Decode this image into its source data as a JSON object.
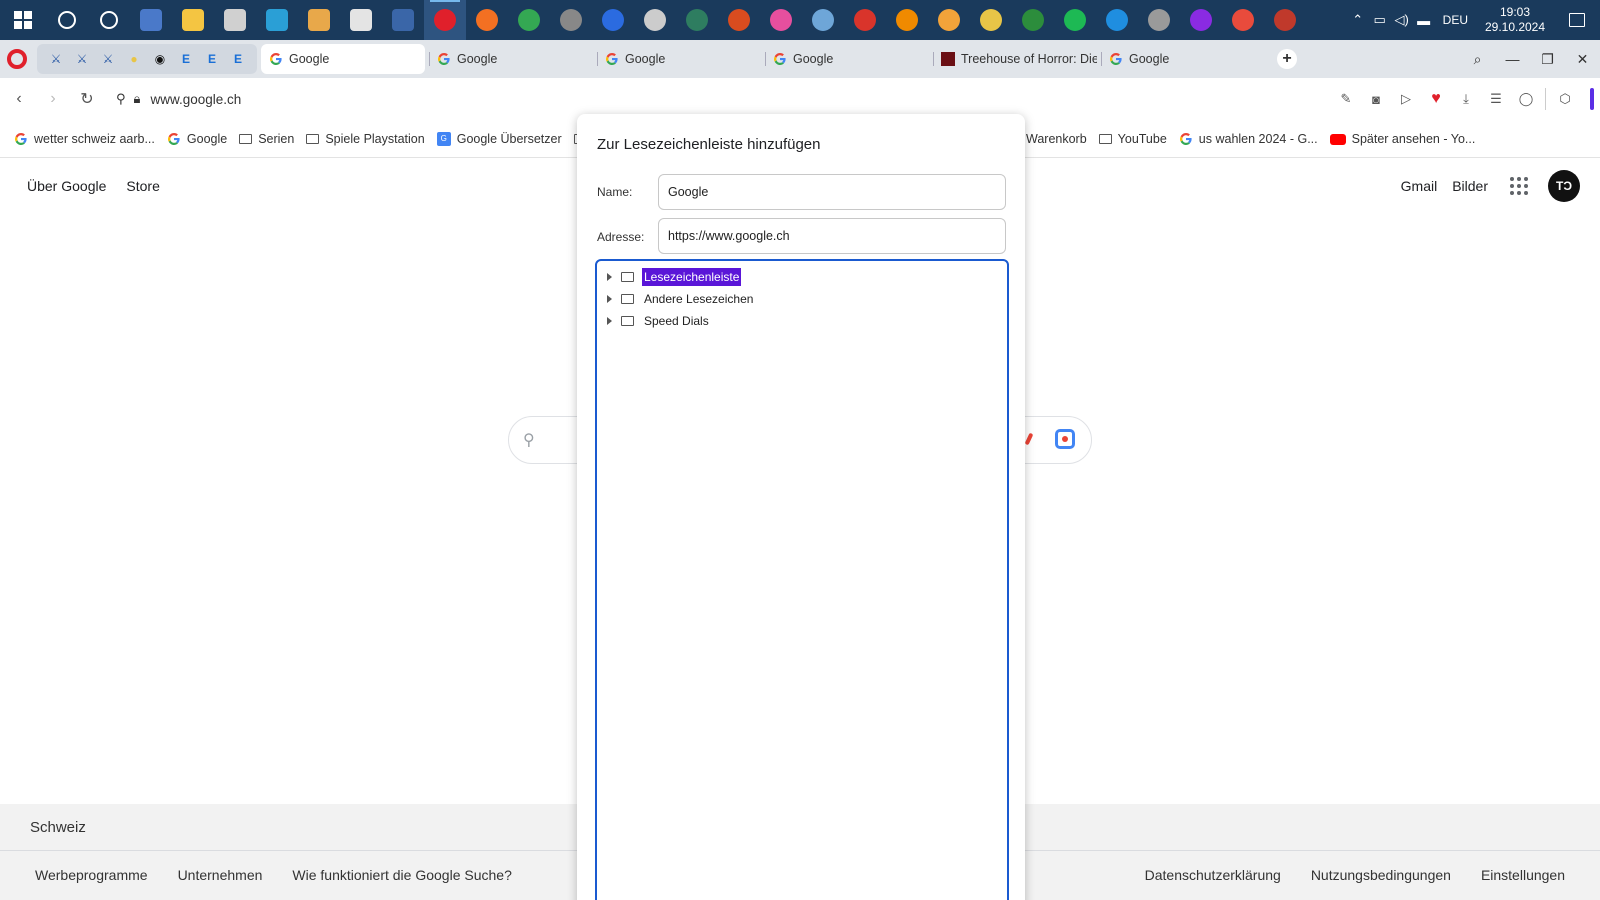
{
  "taskbar": {
    "apps": [
      {
        "name": "search-icon",
        "color": "#ffffff"
      },
      {
        "name": "task-view-icon",
        "color": "#ffffff"
      },
      {
        "name": "notepad-icon",
        "color": "#4a79c9"
      },
      {
        "name": "file-explorer-icon",
        "color": "#f4c542"
      },
      {
        "name": "app-icon",
        "color": "#d0d0d0"
      },
      {
        "name": "app-icon",
        "color": "#2a9fd6"
      },
      {
        "name": "app-icon",
        "color": "#e8a84a"
      },
      {
        "name": "paint-icon",
        "color": "#e4e4e4"
      },
      {
        "name": "app-icon",
        "color": "#3a66a8"
      },
      {
        "name": "opera-icon",
        "color": "#e0202b"
      },
      {
        "name": "firefox-icon",
        "color": "#f37022"
      },
      {
        "name": "chrome-icon",
        "color": "#34a853"
      },
      {
        "name": "app-icon",
        "color": "#888888"
      },
      {
        "name": "app-icon",
        "color": "#2b6be0"
      },
      {
        "name": "app-icon",
        "color": "#cccccc"
      },
      {
        "name": "app-icon",
        "color": "#2e7d60"
      },
      {
        "name": "app-icon",
        "color": "#d94c1f"
      },
      {
        "name": "itunes-icon",
        "color": "#e64f9e"
      },
      {
        "name": "app-icon",
        "color": "#6ea6d8"
      },
      {
        "name": "pdf-icon",
        "color": "#d9342b"
      },
      {
        "name": "vlc-icon",
        "color": "#f08a00"
      },
      {
        "name": "app-icon",
        "color": "#f2a33a"
      },
      {
        "name": "app-icon",
        "color": "#e8c547"
      },
      {
        "name": "app-icon",
        "color": "#2c8d3c"
      },
      {
        "name": "spotify-icon",
        "color": "#1db954"
      },
      {
        "name": "app-icon",
        "color": "#1f8ee0"
      },
      {
        "name": "app-icon",
        "color": "#9a9a9a"
      },
      {
        "name": "app-icon",
        "color": "#8a2be2"
      },
      {
        "name": "app-icon",
        "color": "#e94b3c"
      },
      {
        "name": "app-icon",
        "color": "#c0392b"
      }
    ],
    "tray": {
      "language": "DEU",
      "time": "19:03",
      "date": "29.10.2024"
    }
  },
  "tabs": [
    {
      "label": "Google",
      "active": true
    },
    {
      "label": "Google",
      "active": false
    },
    {
      "label": "Google",
      "active": false
    },
    {
      "label": "Google",
      "active": false
    },
    {
      "label": "Treehouse of Horror: Die S",
      "active": false
    },
    {
      "label": "Google",
      "active": false
    }
  ],
  "address_bar": {
    "url": "www.google.ch"
  },
  "bookmarks_bar": {
    "left": [
      {
        "label": "wetter schweiz aarb...",
        "icon": "google"
      },
      {
        "label": "Google",
        "icon": "google"
      },
      {
        "label": "Serien",
        "icon": "folder"
      },
      {
        "label": "Spiele Playstation",
        "icon": "folder"
      },
      {
        "label": "Google Übersetzer",
        "icon": "translate"
      }
    ],
    "right": [
      {
        "label": "Warenkorb",
        "icon": "none"
      },
      {
        "label": "YouTube",
        "icon": "folder"
      },
      {
        "label": "us wahlen 2024 - G...",
        "icon": "google"
      },
      {
        "label": "Später ansehen - Yo...",
        "icon": "youtube"
      }
    ]
  },
  "google_page": {
    "top_left_links": [
      "Über Google",
      "Store"
    ],
    "top_right_links": [
      "Gmail",
      "Bilder"
    ],
    "avatar_text": "TƆ",
    "footer": {
      "country": "Schweiz",
      "left_links": [
        "Werbeprogramme",
        "Unternehmen",
        "Wie funktioniert die Google Suche?"
      ],
      "right_links": [
        "Datenschutzerklärung",
        "Nutzungsbedingungen",
        "Einstellungen"
      ]
    }
  },
  "bookmark_dialog": {
    "title": "Zur Lesezeichenleiste hinzufügen",
    "name_label": "Name:",
    "name_value": "Google",
    "address_label": "Adresse:",
    "address_value": "https://www.google.ch",
    "folders": [
      {
        "label": "Lesezeichenleiste",
        "selected": true
      },
      {
        "label": "Andere Lesezeichen",
        "selected": false
      },
      {
        "label": "Speed Dials",
        "selected": false
      }
    ]
  },
  "colors": {
    "taskbar": "#1a3a5c",
    "selection": "#5a16d8",
    "focus_border": "#1a5ad0",
    "opera_red": "#e0202b"
  }
}
